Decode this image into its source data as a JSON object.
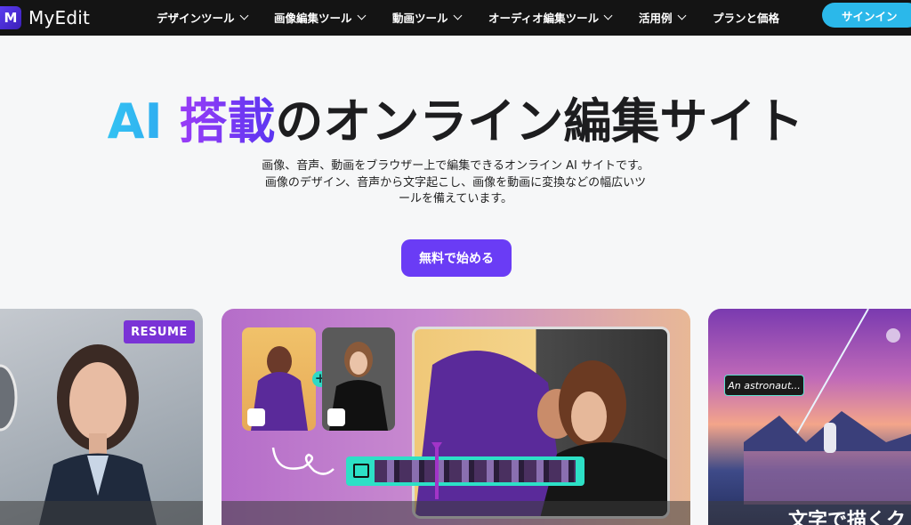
{
  "brand": {
    "name": "MyEdit",
    "mark": "M"
  },
  "nav": {
    "items": [
      {
        "label": "デザインツール",
        "has_dropdown": true
      },
      {
        "label": "画像編集ツール",
        "has_dropdown": true
      },
      {
        "label": "動画ツール",
        "has_dropdown": true
      },
      {
        "label": "オーディオ編集ツール",
        "has_dropdown": true
      },
      {
        "label": "活用例",
        "has_dropdown": true
      },
      {
        "label": "プランと価格",
        "has_dropdown": false
      }
    ],
    "signin_label": "サインイン"
  },
  "hero": {
    "title_ai": "AI ",
    "title_tosai": "搭載",
    "title_rest": "のオンライン編集サイト",
    "desc_line1": "画像、音声、動画をブラウザー上で編集できるオンライン AI サイトです。",
    "desc_line2": "画像のデザイン、音声から文字起こし、画像を動画に変換などの幅広いツ",
    "desc_line3": "ールを備えています。",
    "cta_label": "無料で始める"
  },
  "cards": {
    "left": {
      "badge": "RESUME"
    },
    "right": {
      "prompt_tag": "An astronaut...",
      "caption": "文字で描くク"
    }
  },
  "colors": {
    "nav_bg": "#141414",
    "signin": "#2bb8ea",
    "cta": "#6a3cf5",
    "accent_teal": "#2de0c6",
    "accent_purple": "#7a33d6"
  }
}
